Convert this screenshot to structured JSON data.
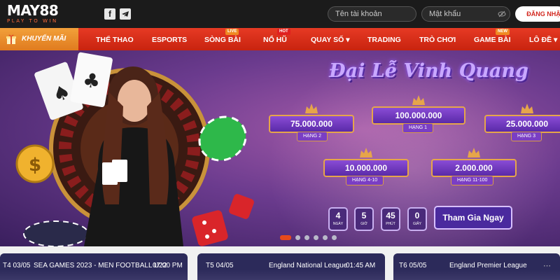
{
  "brand": {
    "name": "MAY88",
    "tagline": "PLAY TO WIN"
  },
  "header": {
    "username_placeholder": "Tên tài khoản",
    "password_placeholder": "Mật khẩu",
    "login_label": "ĐĂNG NHẬP"
  },
  "nav": {
    "promo_label": "KHUYẾN MÃI",
    "items": [
      {
        "label": "THỂ THAO"
      },
      {
        "label": "ESPORTS"
      },
      {
        "label": "SÒNG BÀI",
        "badge": "LIVE"
      },
      {
        "label": "NỔ HŨ",
        "badge": "HOT"
      },
      {
        "label": "QUAY SỐ ▾"
      },
      {
        "label": "TRADING"
      },
      {
        "label": "TRÒ CHƠI"
      },
      {
        "label": "GAME BÀI",
        "badge": "NEW"
      },
      {
        "label": "LÔ ĐỀ ▾"
      }
    ]
  },
  "banner": {
    "title": "Đại Lễ Vinh Quang",
    "prizes": [
      {
        "amount": "100.000.000",
        "rank": "HẠNG 1"
      },
      {
        "amount": "75.000.000",
        "rank": "HẠNG 2"
      },
      {
        "amount": "25.000.000",
        "rank": "HẠNG 3"
      },
      {
        "amount": "10.000.000",
        "rank": "HẠNG 4-10"
      },
      {
        "amount": "2.000.000",
        "rank": "HẠNG 11-100"
      }
    ],
    "countdown": [
      {
        "value": "4",
        "unit": "NGÀY"
      },
      {
        "value": "5",
        "unit": "GIỜ"
      },
      {
        "value": "45",
        "unit": "PHÚT"
      },
      {
        "value": "0",
        "unit": "GIÂY"
      }
    ],
    "join_label": "Tham Gia Ngay",
    "slide_count": 7,
    "active_slide": 1
  },
  "matches": [
    {
      "date": "T4 03/05",
      "league": "SEA GAMES 2023 - MEN FOOTBALL U22",
      "time": "07:00 PM"
    },
    {
      "date": "T5 04/05",
      "league": "England National League",
      "time": "01:45 AM"
    },
    {
      "date": "T6 05/05",
      "league": "England Premier League",
      "time": ""
    }
  ],
  "colors": {
    "accent": "#e63a24",
    "promo": "#f2a03a",
    "banner": "#6b3b8e",
    "card": "#2c2a5a"
  }
}
